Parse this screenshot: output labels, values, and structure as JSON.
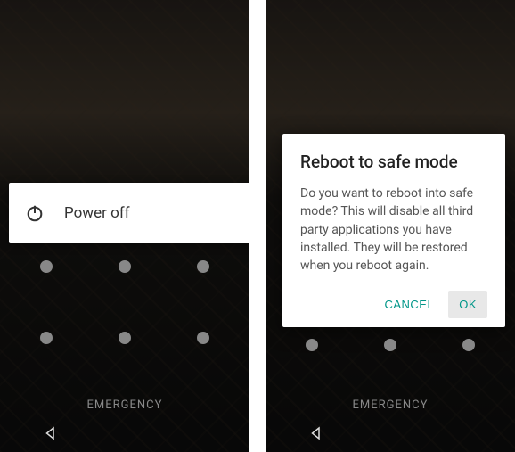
{
  "left": {
    "power_menu": {
      "power_off_label": "Power off"
    },
    "emergency_label": "EMERGENCY"
  },
  "right": {
    "dialog": {
      "title": "Reboot to safe mode",
      "body": "Do you want to reboot into safe mode? This will disable all third party applications you have installed. They will be restored when you reboot again.",
      "cancel_label": "CANCEL",
      "ok_label": "OK"
    },
    "emergency_label": "EMERGENCY"
  },
  "colors": {
    "accent": "#009688"
  }
}
